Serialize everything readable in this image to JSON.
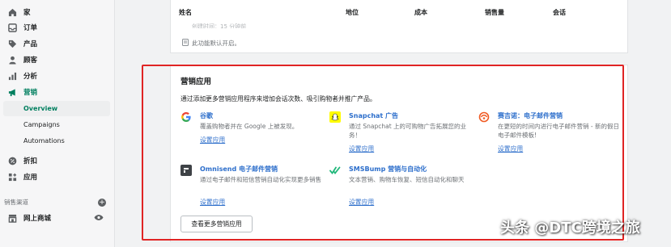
{
  "sidebar": {
    "items": [
      {
        "label": "家",
        "icon": "home-icon"
      },
      {
        "label": "订单",
        "icon": "orders-icon"
      },
      {
        "label": "产品",
        "icon": "tag-icon"
      },
      {
        "label": "顾客",
        "icon": "customer-icon"
      },
      {
        "label": "分析",
        "icon": "analytics-icon"
      },
      {
        "label": "营销",
        "icon": "megaphone-icon"
      },
      {
        "label": "折扣",
        "icon": "discount-icon"
      },
      {
        "label": "应用",
        "icon": "apps-icon"
      }
    ],
    "marketing_sub": [
      "Overview",
      "Campaigns",
      "Automations"
    ],
    "channels_label": "销售渠道",
    "online_store_label": "网上商城"
  },
  "table": {
    "headers": [
      "姓名",
      "地位",
      "成本",
      "销售量",
      "会话"
    ],
    "faded_text": "创建时间：15 分钟前",
    "info": "此功能默认开启。"
  },
  "marketing_apps": {
    "title": "营销应用",
    "description": "通过添加更多营销应用程序来增加会话次数、吸引购物者并推广产品。",
    "apps": [
      {
        "name": "谷歌",
        "desc": "覆盖购物者并在 Google 上被发现。",
        "link": "设置应用",
        "icon": "google-icon"
      },
      {
        "name": "Snapchat 广告",
        "desc": "通过 Snapchat 上的可购物广告拓展您的业务！",
        "link": "设置应用",
        "icon": "snapchat-icon"
      },
      {
        "name": "赛吉诺：电子邮件营销",
        "desc": "在更短的时间内进行电子邮件营销 - 新的假日电子邮件模板!",
        "link": "设置应用",
        "icon": "seguno-icon"
      },
      {
        "name": "Omnisend 电子邮件营销",
        "desc": "通过电子邮件和短信营销自动化实现更多销售",
        "link": "设置应用",
        "icon": "omnisend-icon"
      },
      {
        "name": "SMSBump 营销与自动化",
        "desc": "文本营销、购物车恢复、短信自动化和聊天",
        "link": "设置应用",
        "icon": "smsbump-icon"
      }
    ],
    "more_button": "查看更多营销应用"
  },
  "watermark": "头条 @DTC跨境之旅",
  "colors": {
    "accent": "#007f5f",
    "link": "#2c6ecb",
    "highlight": "#e02424"
  }
}
